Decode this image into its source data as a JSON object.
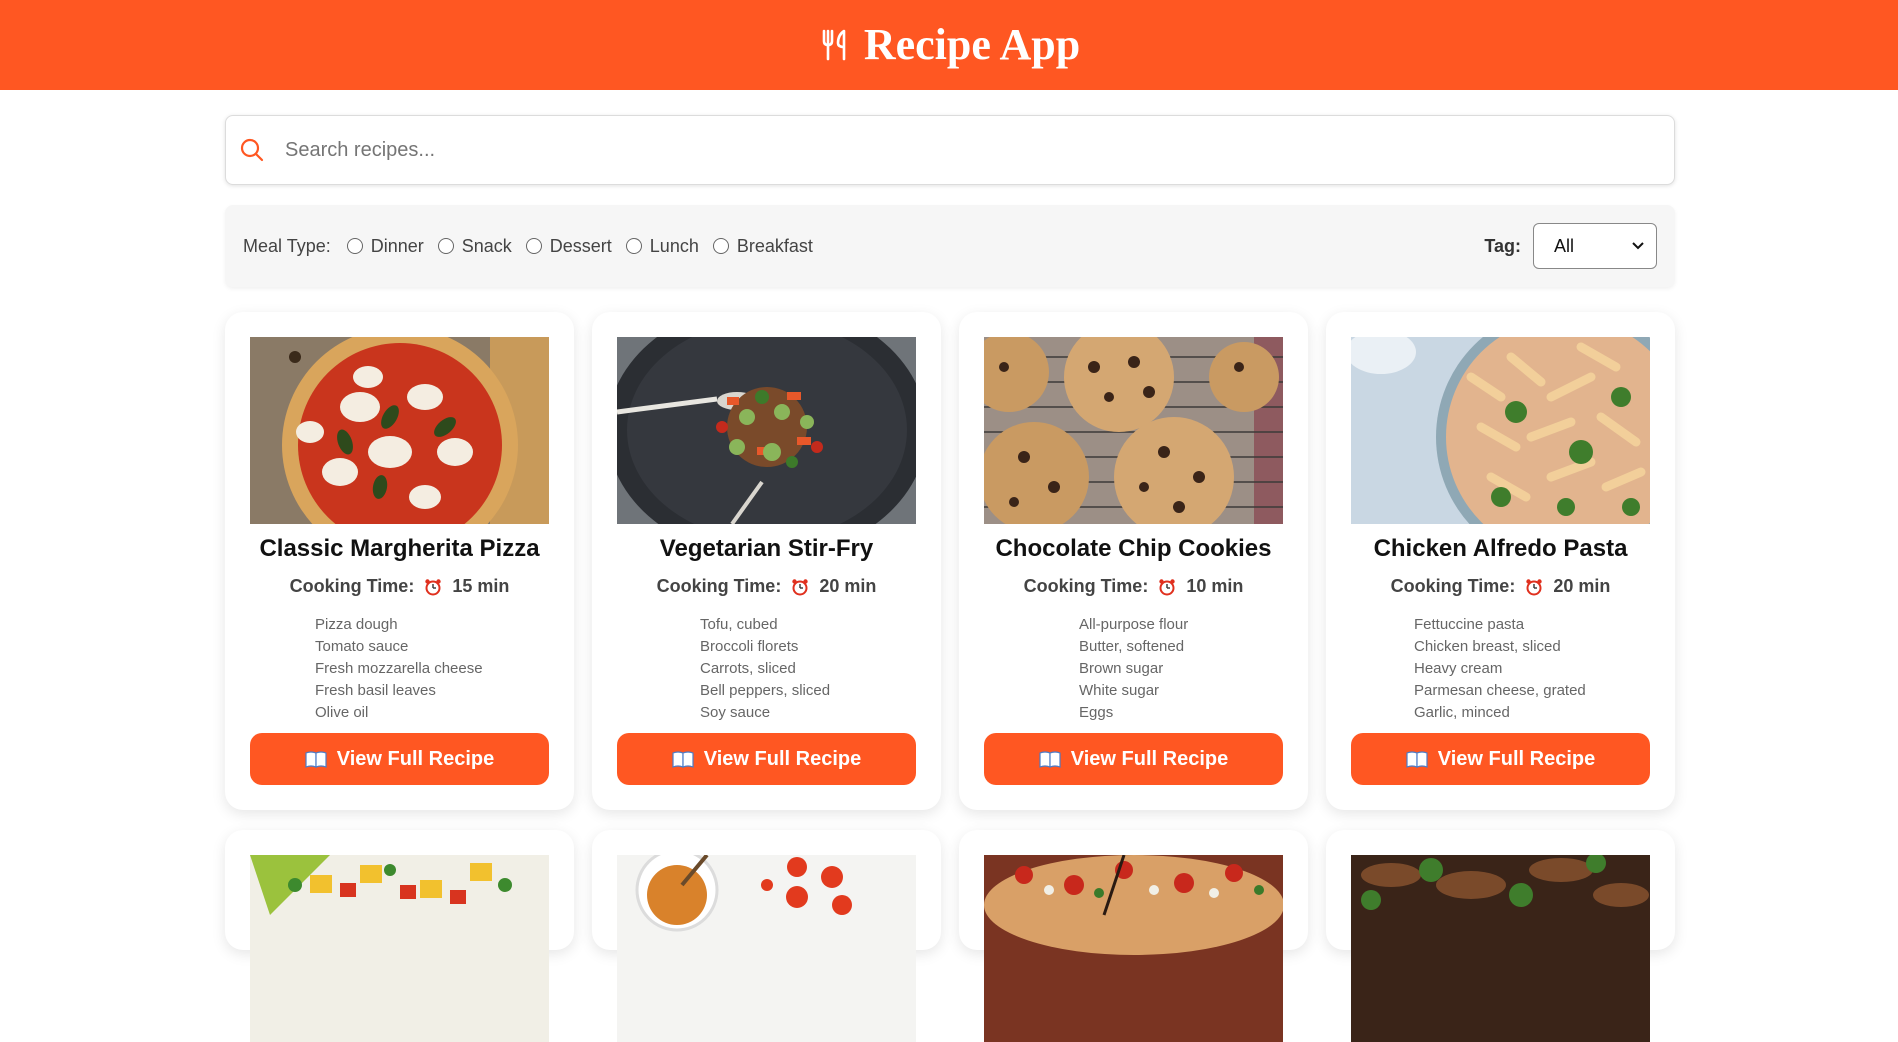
{
  "app": {
    "title": "Recipe App",
    "icon": "utensils-icon",
    "accent_color": "#ff5722"
  },
  "search": {
    "placeholder": "Search recipes...",
    "value": ""
  },
  "filters": {
    "meal_type_label": "Meal Type:",
    "meal_types": [
      "Dinner",
      "Snack",
      "Dessert",
      "Lunch",
      "Breakfast"
    ],
    "tag_label": "Tag:",
    "tag_selected": "All"
  },
  "recipes": [
    {
      "name": "Classic Margherita Pizza",
      "time_label": "Cooking Time:",
      "time": "15 min",
      "ingredients": [
        "Pizza dough",
        "Tomato sauce",
        "Fresh mozzarella cheese",
        "Fresh basil leaves",
        "Olive oil"
      ],
      "button": "View Full Recipe"
    },
    {
      "name": "Vegetarian Stir-Fry",
      "time_label": "Cooking Time:",
      "time": "20 min",
      "ingredients": [
        "Tofu, cubed",
        "Broccoli florets",
        "Carrots, sliced",
        "Bell peppers, sliced",
        "Soy sauce"
      ],
      "button": "View Full Recipe"
    },
    {
      "name": "Chocolate Chip Cookies",
      "time_label": "Cooking Time:",
      "time": "10 min",
      "ingredients": [
        "All-purpose flour",
        "Butter, softened",
        "Brown sugar",
        "White sugar",
        "Eggs"
      ],
      "button": "View Full Recipe"
    },
    {
      "name": "Chicken Alfredo Pasta",
      "time_label": "Cooking Time:",
      "time": "20 min",
      "ingredients": [
        "Fettuccine pasta",
        "Chicken breast, sliced",
        "Heavy cream",
        "Parmesan cheese, grated",
        "Garlic, minced"
      ],
      "button": "View Full Recipe"
    }
  ]
}
